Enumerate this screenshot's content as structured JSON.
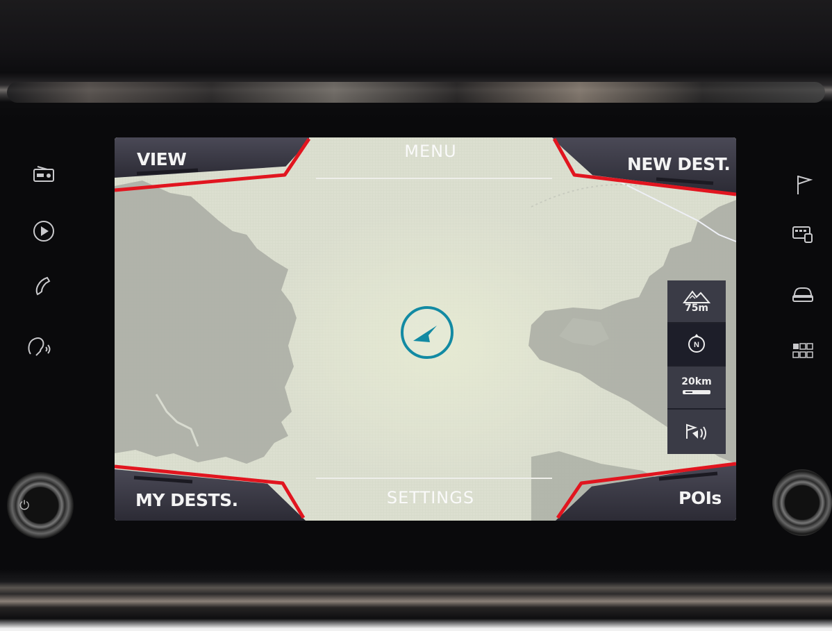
{
  "header": {
    "left_label": "VIEW",
    "center_label": "MENU",
    "right_label": "NEW DEST."
  },
  "footer": {
    "left_label": "MY DESTS.",
    "center_label": "SETTINGS",
    "right_label": "POIs"
  },
  "map_controls": {
    "altitude_label": "75m",
    "north_label": "N",
    "scale_label": "20km"
  },
  "left_hardware_icons": [
    "radio-icon",
    "media-play-icon",
    "phone-icon",
    "voice-icon"
  ],
  "right_hardware_icons": [
    "navigation-flag-icon",
    "traffic-info-icon",
    "car-icon",
    "apps-grid-icon"
  ],
  "colors": {
    "accent_red": "#e1151f",
    "compass_teal": "#128aa3",
    "bar_dark": "#2f2e39",
    "map_land": "#a9aca3",
    "map_water": "#dcdfd0"
  }
}
